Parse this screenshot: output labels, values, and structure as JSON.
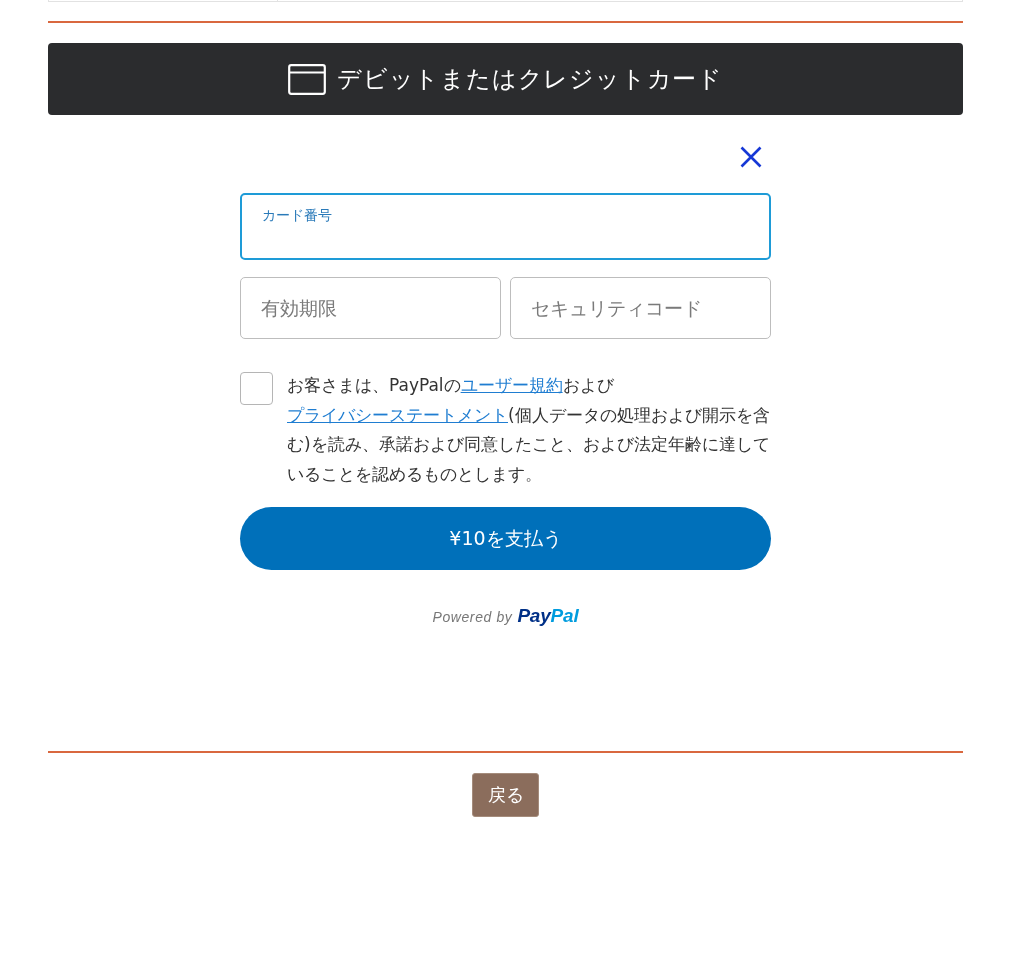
{
  "header": {
    "title": "デビットまたはクレジットカード"
  },
  "card_number": {
    "label": "カード番号",
    "focused": true
  },
  "fields": [
    {
      "placeholder": "有効期限"
    },
    {
      "placeholder": "セキュリティコード"
    }
  ],
  "consent": {
    "checked": false,
    "parts": [
      {
        "kind": "text",
        "text": "お客さまは、PayPalの"
      },
      {
        "kind": "link",
        "text": "ユーザー規約"
      },
      {
        "kind": "text",
        "text": "および"
      },
      {
        "kind": "link",
        "text": "プライバシーステートメント"
      },
      {
        "kind": "text",
        "text": "(個人データの処理および開示を含む)を読み、承諾および同意したこと、および法定年齢に達していることを認めるものとします。"
      }
    ]
  },
  "pay_button": "¥10を支払う",
  "powered_by": {
    "text": "Powered by",
    "logo": [
      {
        "text": "Pay",
        "color": "#003087"
      },
      {
        "text": "Pal",
        "color": "#009cde"
      }
    ]
  },
  "back_button": "戻る"
}
